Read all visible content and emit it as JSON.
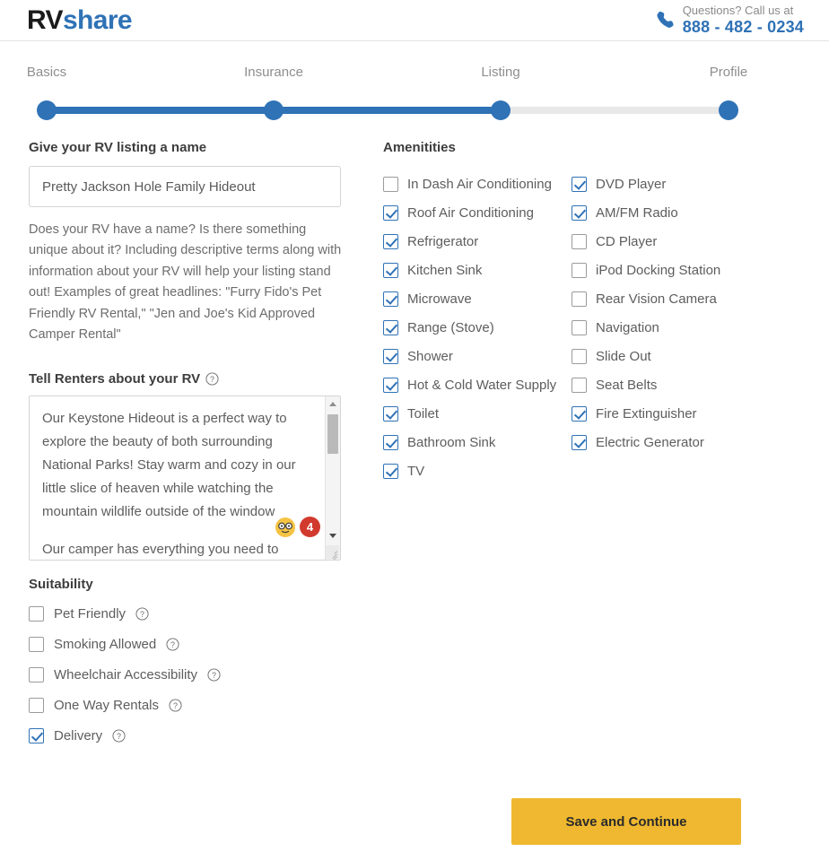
{
  "header": {
    "logo_rv": "RV",
    "logo_share": "share",
    "phone_icon": "phone-icon",
    "phone_question": "Questions? Call us at",
    "phone_number": "888 - 482 - 0234",
    "logo_dark_color": "#1b1b1b",
    "brand_blue": "#2f72b6"
  },
  "progress": {
    "steps": [
      {
        "label": "Basics",
        "x_pct": 6.0,
        "complete": true
      },
      {
        "label": "Insurance",
        "x_pct": 33.0,
        "complete": true
      },
      {
        "label": "Listing",
        "x_pct": 60.5,
        "complete": true
      },
      {
        "label": "Profile",
        "x_pct": 88.0,
        "complete": false
      }
    ],
    "fill_color": "#2f72b6",
    "track_color": "#e8e8e8"
  },
  "listing_name": {
    "title": "Give your RV listing a name",
    "value": "Pretty Jackson Hole Family Hideout",
    "placeholder": "Give your RV listing a name",
    "helper": "Does your RV have a name? Is there something unique about it? Including descriptive terms along with information about your RV will help your listing stand out! Examples of great headlines: \"Furry Fido's Pet Friendly RV Rental,\" \"Jen and Joe's Kid Approved Camper Rental\""
  },
  "description": {
    "title": "Tell Renters about your RV",
    "help_icon": "question-circle-icon",
    "paragraph_1": "Our Keystone Hideout is a perfect way to explore the beauty of both surrounding National Parks! Stay warm and cozy in our little slice of heaven while watching the mountain wildlife outside of the window",
    "paragraph_2": "Our camper has everything you need to",
    "grammar_badge": {
      "emoji_icon": "nerd-face-emoji-icon",
      "count": "4",
      "count_color": "#d23a2e"
    }
  },
  "suitability": {
    "title": "Suitability",
    "options": [
      {
        "label": "Pet Friendly",
        "checked": false,
        "help": true
      },
      {
        "label": "Smoking Allowed",
        "checked": false,
        "help": true
      },
      {
        "label": "Wheelchair Accessibility",
        "checked": false,
        "help": true
      },
      {
        "label": "One Way Rentals",
        "checked": false,
        "help": true
      },
      {
        "label": "Delivery",
        "checked": true,
        "help": true
      }
    ]
  },
  "amenities": {
    "title": "Amenitities",
    "column_1": [
      {
        "label": "In Dash Air Conditioning",
        "checked": false
      },
      {
        "label": "Roof Air Conditioning",
        "checked": true
      },
      {
        "label": "Refrigerator",
        "checked": true
      },
      {
        "label": "Kitchen Sink",
        "checked": true
      },
      {
        "label": "Microwave",
        "checked": true
      },
      {
        "label": "Range (Stove)",
        "checked": true
      },
      {
        "label": "Shower",
        "checked": true
      },
      {
        "label": "Hot & Cold Water Supply",
        "checked": true
      },
      {
        "label": "Toilet",
        "checked": true
      },
      {
        "label": "Bathroom Sink",
        "checked": true
      },
      {
        "label": "TV",
        "checked": true
      }
    ],
    "column_2": [
      {
        "label": "DVD Player",
        "checked": true
      },
      {
        "label": "AM/FM Radio",
        "checked": true
      },
      {
        "label": "CD Player",
        "checked": false
      },
      {
        "label": "iPod Docking Station",
        "checked": false
      },
      {
        "label": "Rear Vision Camera",
        "checked": false
      },
      {
        "label": "Navigation",
        "checked": false
      },
      {
        "label": "Slide Out",
        "checked": false
      },
      {
        "label": "Seat Belts",
        "checked": false
      },
      {
        "label": "Fire Extinguisher",
        "checked": true
      },
      {
        "label": "Electric Generator",
        "checked": true
      }
    ]
  },
  "footer": {
    "save_label": "Save and Continue",
    "save_color": "#efb830"
  }
}
